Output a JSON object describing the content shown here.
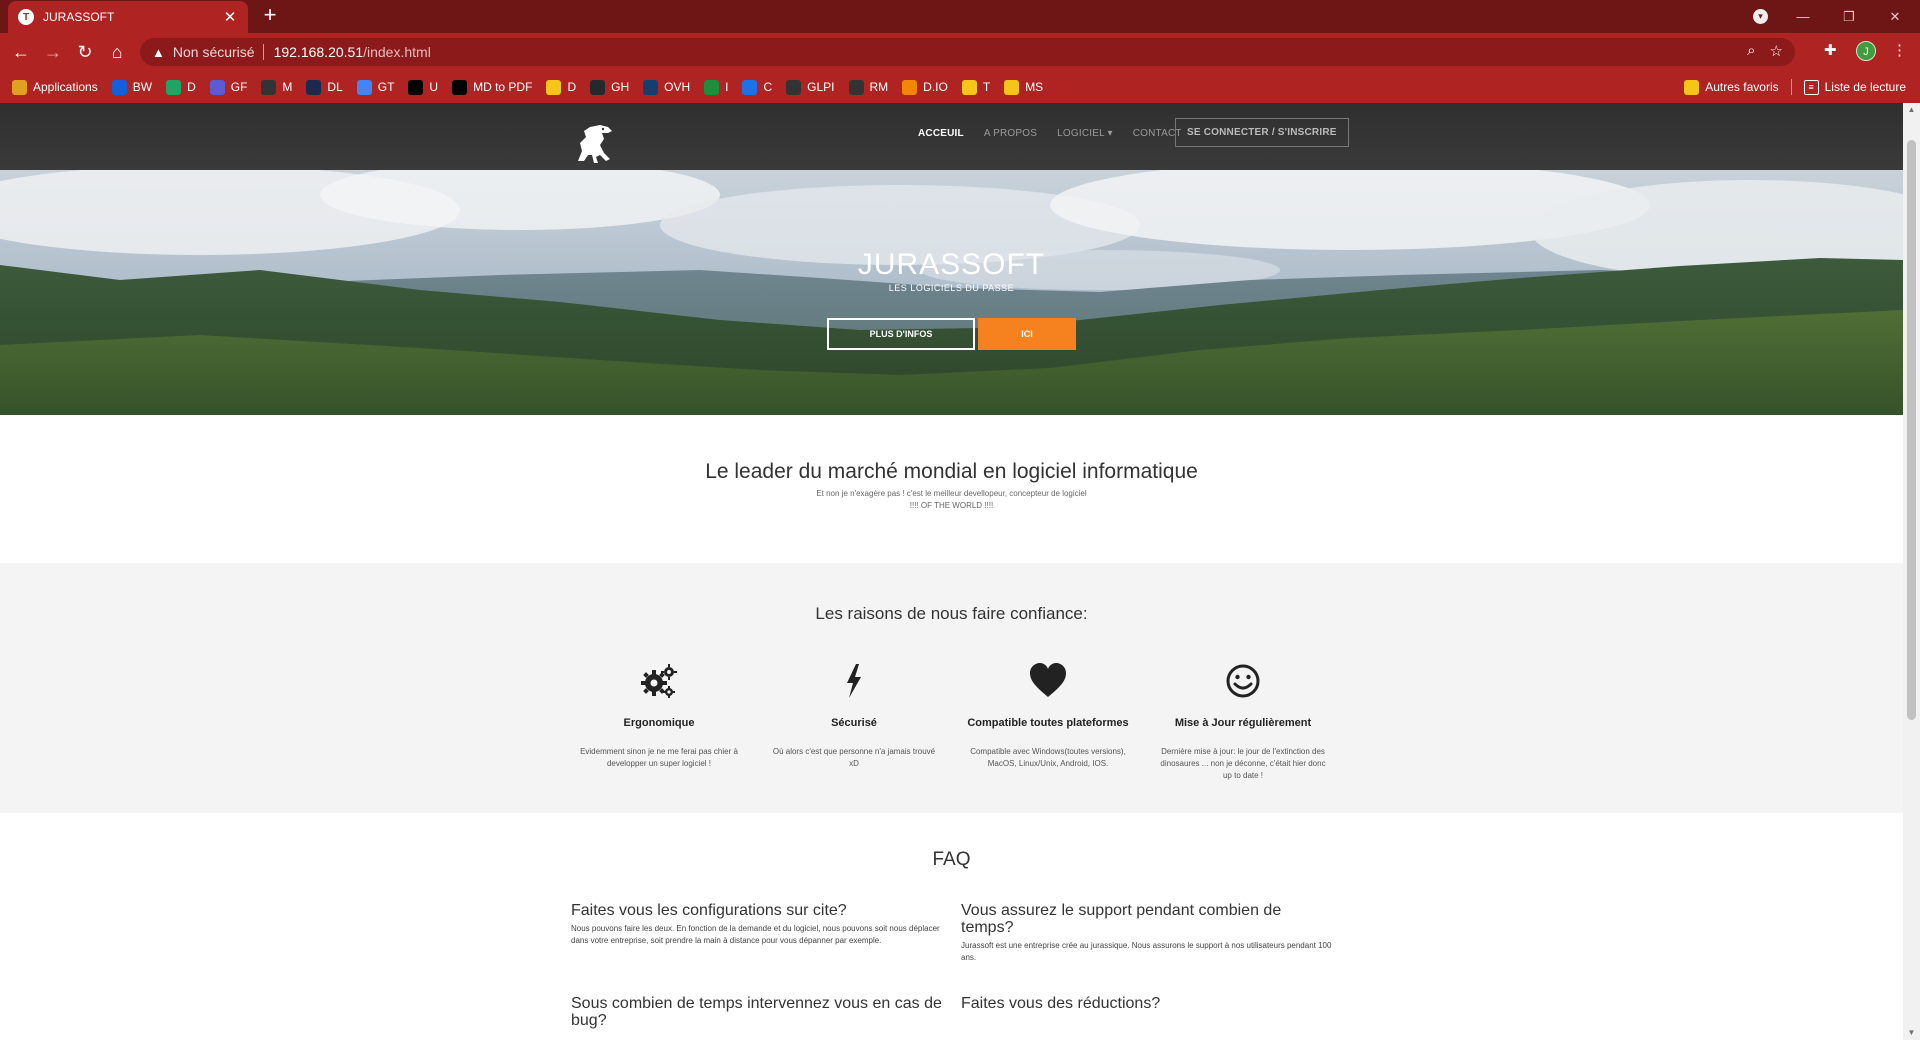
{
  "browser": {
    "tab_title": "JURASSOFT",
    "tab_favicon_letter": "T",
    "profile_initial": "J",
    "security_label": "Non sécurisé",
    "url_host": "192.168.20.51",
    "url_path": "/index.html",
    "bookmarks": [
      {
        "label": "Applications",
        "color": "#e0a020"
      },
      {
        "label": "BW",
        "color": "#175ddc"
      },
      {
        "label": "D",
        "color": "#1fa463"
      },
      {
        "label": "GF",
        "color": "#5b5bd6"
      },
      {
        "label": "M",
        "color": "#333333"
      },
      {
        "label": "DL",
        "color": "#1b2a4a"
      },
      {
        "label": "GT",
        "color": "#4285f4"
      },
      {
        "label": "U",
        "color": "#000000"
      },
      {
        "label": "MD to PDF",
        "color": "#000000"
      },
      {
        "label": "D",
        "color": "#f5c518"
      },
      {
        "label": "GH",
        "color": "#24292e"
      },
      {
        "label": "OVH",
        "color": "#123f6d"
      },
      {
        "label": "I",
        "color": "#1e8e3e"
      },
      {
        "label": "C",
        "color": "#1a73e8"
      },
      {
        "label": "GLPI",
        "color": "#333333"
      },
      {
        "label": "RM",
        "color": "#333333"
      },
      {
        "label": "D.IO",
        "color": "#f08705"
      },
      {
        "label": "T",
        "color": "#f5c518"
      },
      {
        "label": "MS",
        "color": "#f5c518"
      }
    ],
    "other_bookmarks": "Autres favoris",
    "reading_list": "Liste de lecture"
  },
  "site": {
    "nav": {
      "home": "ACCEUIL",
      "about": "A PROPOS",
      "software": "LOGICIEL ▾",
      "contact": "CONTACT",
      "login": "SE CONNECTER / S'INSCRIRE"
    },
    "hero": {
      "title": "JURASSOFT",
      "subtitle": "LES LOGICIELS DU PASSE",
      "more_button": "PLUS D'INFOS",
      "here_button": "ICI"
    },
    "lead": {
      "title": "Le leader du marché mondial en logiciel informatique",
      "line1": "Et non je n'exagère pas ! c'est le meilleur devellopeur, concepteur de logiciel",
      "line2": "!!!! OF THE WORLD !!!!"
    },
    "reasons": {
      "title": "Les raisons de nous faire confiance:",
      "items": [
        {
          "icon": "gears-icon",
          "title": "Ergonomique",
          "text": "Evidemment sinon je ne me ferai pas chier à developper un super logiciel !"
        },
        {
          "icon": "lightning-icon",
          "title": "Sécurisé",
          "text": "Où alors c'est que personne n'a jamais trouvé xD"
        },
        {
          "icon": "heart-icon",
          "title": "Compatible toutes plateformes",
          "text": "Compatible avec Windows(toutes versions), MacOS, Linux/Unix, Android, IOS."
        },
        {
          "icon": "smiley-icon",
          "title": "Mise à Jour régulièrement",
          "text": "Dernière mise à jour: le jour de l'extinction des dinosaures ... non je déconne, c'était hier donc up to date !"
        }
      ]
    },
    "faq": {
      "title": "FAQ",
      "items": [
        {
          "q": "Faites vous les configurations sur cite?",
          "a": "Nous pouvons faire les deux. En fonction de la demande et du logiciel, nous pouvons soit nous déplacer dans votre entreprise, soit prendre la main à distance pour vous dépanner par exemple."
        },
        {
          "q": "Vous assurez le support pendant combien de temps?",
          "a": "Jurassoft est une entreprise crée au jurassique. Nous assurons le support à nos utilisateurs pendant 100 ans."
        },
        {
          "q": "Sous combien de temps intervennez vous en cas de bug?",
          "a": ""
        },
        {
          "q": "Faites vous des réductions?",
          "a": ""
        }
      ]
    }
  },
  "colors": {
    "chrome_dark": "#6e1616",
    "chrome": "#b02323",
    "accent_orange": "#f5821f",
    "header_dark": "#333333"
  }
}
